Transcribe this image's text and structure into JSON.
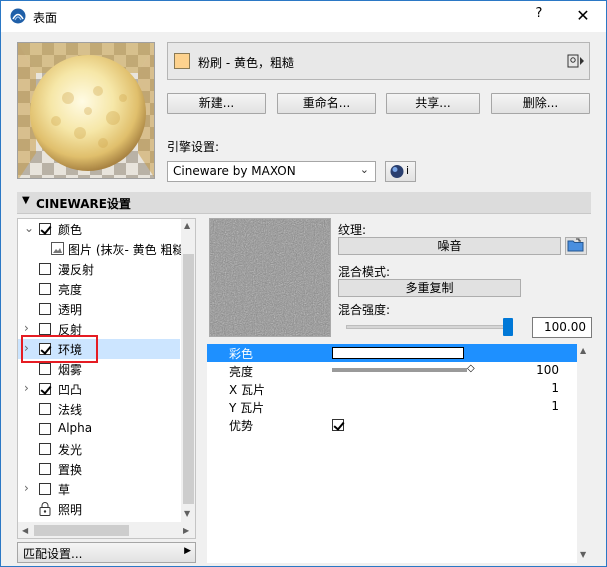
{
  "window": {
    "title": "表面",
    "help": "?",
    "close": "✕"
  },
  "surface": {
    "name": "粉刷 - 黄色，粗糙",
    "swatch_color": "#fdd28e"
  },
  "buttons": {
    "new": "新建...",
    "rename": "重命名...",
    "share": "共享...",
    "delete": "删除..."
  },
  "engine": {
    "label": "引擎设置:",
    "value": "Cineware by MAXON",
    "info_label": "i"
  },
  "section": {
    "title": "CINEWARE设置"
  },
  "tree": {
    "items": [
      {
        "label": "颜色",
        "checked": true,
        "expander": "⌄"
      },
      {
        "label": "图片 (抹灰- 黄色 粗糙",
        "type": "image"
      },
      {
        "label": "漫反射",
        "checked": false
      },
      {
        "label": "亮度",
        "checked": false
      },
      {
        "label": "透明",
        "checked": false
      },
      {
        "label": "反射",
        "checked": false,
        "expander": "›"
      },
      {
        "label": "环境",
        "checked": true,
        "expander": "›",
        "selected": true
      },
      {
        "label": "烟雾",
        "checked": false
      },
      {
        "label": "凹凸",
        "checked": true,
        "expander": "›"
      },
      {
        "label": "法线",
        "checked": false
      },
      {
        "label": "Alpha",
        "checked": false
      },
      {
        "label": "发光",
        "checked": false
      },
      {
        "label": "置换",
        "checked": false
      },
      {
        "label": "草",
        "checked": false,
        "expander": "›"
      },
      {
        "label": "照明",
        "type": "lock"
      }
    ]
  },
  "match_settings": "匹配设置...",
  "texture": {
    "label": "纹理:",
    "value": "噪音",
    "blend_mode_label": "混合模式:",
    "blend_mode_value": "多重复制",
    "blend_strength_label": "混合强度:",
    "blend_strength_value": "100.00"
  },
  "properties": [
    {
      "name": "彩色",
      "kind": "color",
      "selected": true
    },
    {
      "name": "亮度",
      "kind": "slider",
      "value": "100"
    },
    {
      "name": "X 瓦片",
      "kind": "number",
      "value": "1"
    },
    {
      "name": "Y 瓦片",
      "kind": "number",
      "value": "1"
    },
    {
      "name": "优势",
      "kind": "checkbox",
      "checked": true
    }
  ]
}
